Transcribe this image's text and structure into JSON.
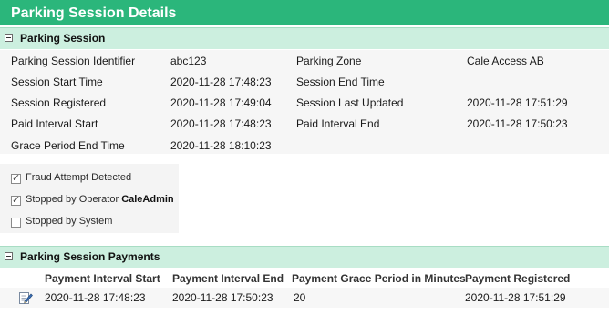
{
  "page": {
    "title": "Parking Session Details"
  },
  "session_section": {
    "header": "Parking Session",
    "fields": {
      "identifier_label": "Parking Session Identifier",
      "identifier_value": "abc123",
      "zone_label": "Parking Zone",
      "zone_value": "Cale Access AB",
      "start_label": "Session Start Time",
      "start_value": "2020-11-28 17:48:23",
      "end_label": "Session End Time",
      "end_value": "",
      "registered_label": "Session Registered",
      "registered_value": "2020-11-28 17:49:04",
      "updated_label": "Session Last Updated",
      "updated_value": "2020-11-28 17:51:29",
      "paid_start_label": "Paid Interval Start",
      "paid_start_value": "2020-11-28 17:48:23",
      "paid_end_label": "Paid Interval End",
      "paid_end_value": "2020-11-28 17:50:23",
      "grace_end_label": "Grace Period End Time",
      "grace_end_value": "2020-11-28 18:10:23"
    }
  },
  "flags": {
    "fraud": {
      "label": "Fraud Attempt Detected",
      "checked": true
    },
    "operator": {
      "label": "Stopped by Operator",
      "operator_name": "CaleAdmin",
      "checked": true
    },
    "system": {
      "label": "Stopped by System",
      "checked": false
    }
  },
  "payments_section": {
    "header": "Parking Session Payments",
    "columns": [
      "Payment Interval Start",
      "Payment Interval End",
      "Payment Grace Period in Minutes",
      "Payment Registered"
    ],
    "rows": [
      {
        "icon": "edit-icon",
        "interval_start": "2020-11-28 17:48:23",
        "interval_end": "2020-11-28 17:50:23",
        "grace_minutes": "20",
        "registered": "2020-11-28 17:51:29"
      }
    ]
  },
  "colors": {
    "title_bar": "#2bb67b",
    "section_header": "#ccefdf",
    "panel_background": "#f6f6f6"
  }
}
